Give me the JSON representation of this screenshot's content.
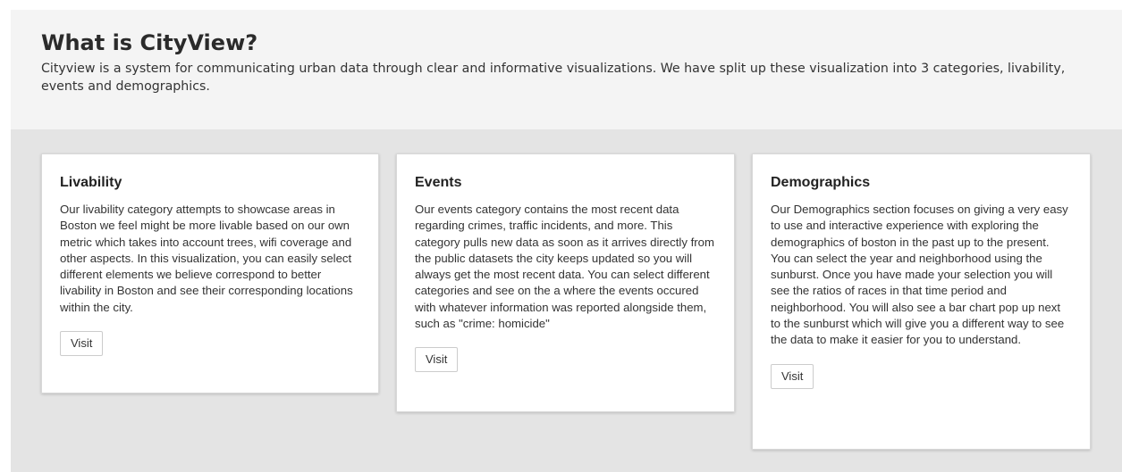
{
  "hero": {
    "title": "What is CityView?",
    "description": "Cityview is a system for communicating urban data through clear and informative visualizations. We have split up these visualization into 3 categories, livability, events and demographics."
  },
  "cards": [
    {
      "title": "Livability",
      "body": "Our livability category attempts to showcase areas in Boston we feel might be more livable based on our own metric which takes into account trees, wifi coverage and other aspects. In this visualization, you can easily select different elements we believe correspond to better livability in Boston and see their corresponding locations within the city.",
      "button": "Visit"
    },
    {
      "title": "Events",
      "body": "Our events category contains the most recent data regarding crimes, traffic incidents, and more. This category pulls new data as soon as it arrives directly from the public datasets the city keeps updated so you will always get the most recent data. You can select different categories and see on the a where the events occured with whatever information was reported alongside them, such as \"crime: homicide\"",
      "button": "Visit"
    },
    {
      "title": "Demographics",
      "body": "Our Demographics section focuses on giving a very easy to use and interactive experience with exploring the demographics of boston in the past up to the present. You can select the year and neighborhood using the sunburst. Once you have made your selection you will see the ratios of races in that time period and neighborhood. You will also see a bar chart pop up next to the sunburst which will give you a different way to see the data to make it easier for you to understand.",
      "button": "Visit"
    }
  ]
}
